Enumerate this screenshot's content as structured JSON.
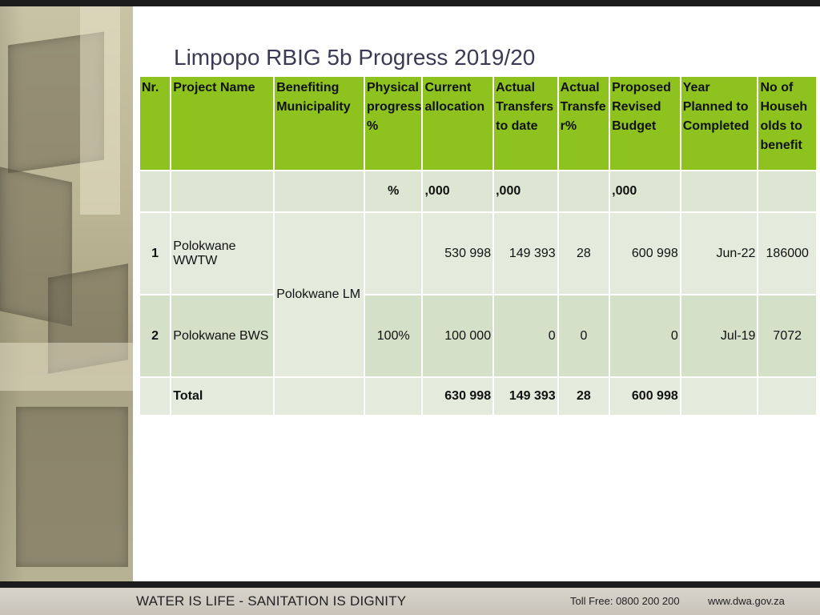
{
  "title": "Limpopo RBIG 5b Progress 2019/20",
  "table": {
    "headers": [
      "Nr.",
      "Project Name",
      "Benefiting Municipality",
      "Physical progress %",
      "Current allocation",
      "Actual Transfers to date",
      "Actual Transfe r%",
      "Proposed Revised Budget",
      "Year Planned to Completed",
      "No of Househ olds to benefit"
    ],
    "units": {
      "physical": "%",
      "allocation": ",000",
      "transfers": ",000",
      "budget": ",000"
    },
    "rows": [
      {
        "nr": "1",
        "project": "Polokwane WWTW",
        "physical": "",
        "allocation": "530 998",
        "transfers": "149 393",
        "transfer_pct": "28",
        "budget": "600 998",
        "year": "Jun-22",
        "households": "186000"
      },
      {
        "nr": "2",
        "project": "Polokwane BWS",
        "physical": "100%",
        "allocation": "100 000",
        "transfers": "0",
        "transfer_pct": "0",
        "budget": "0",
        "year": "Jul-19",
        "households": "7072"
      }
    ],
    "municipality": "Polokwane LM",
    "total": {
      "label": "Total",
      "allocation": "630 998",
      "transfers": "149 393",
      "transfer_pct": "28",
      "budget": "600 998"
    }
  },
  "footer": {
    "slogan": "WATER IS LIFE - SANITATION IS DIGNITY",
    "toll": "Toll Free: 0800 200 200",
    "website": "www.dwa.gov.za"
  },
  "colors": {
    "header_green": "#8dc21f",
    "row_light": "#e4ebdc",
    "row_mid": "#d5e0c8",
    "title": "#3a3a55"
  }
}
